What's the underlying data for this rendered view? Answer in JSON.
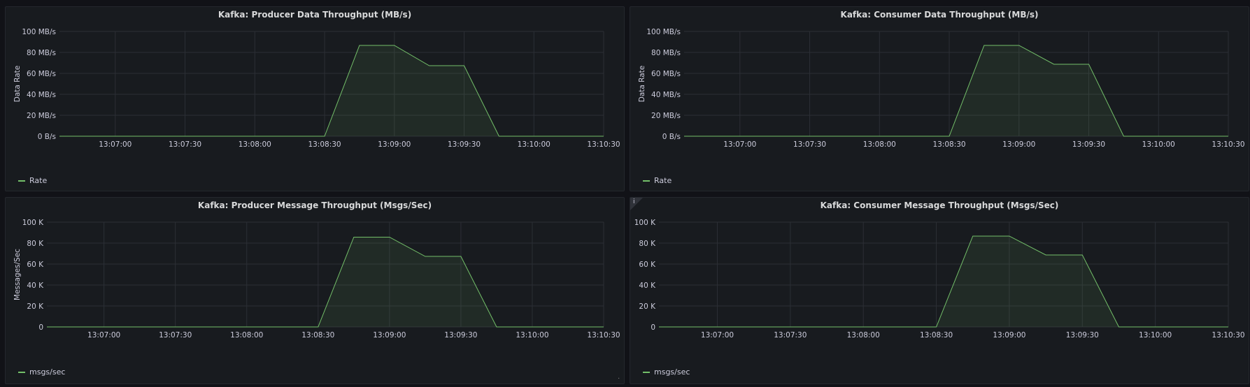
{
  "chart_data": [
    {
      "type": "area",
      "title": "Kafka: Producer Data Throughput (MB/s)",
      "ylabel": "Data Rate",
      "yticks": [
        "0 B/s",
        "20 MB/s",
        "40 MB/s",
        "60 MB/s",
        "80 MB/s",
        "100 MB/s"
      ],
      "ylim": [
        0,
        100
      ],
      "xticks": [
        "13:07:00",
        "13:07:30",
        "13:08:00",
        "13:08:30",
        "13:09:00",
        "13:09:30",
        "13:10:00",
        "13:10:30"
      ],
      "series": [
        {
          "name": "Rate",
          "color": "#73bf69",
          "x": [
            "13:06:36",
            "13:08:30",
            "13:08:45",
            "13:09:00",
            "13:09:15",
            "13:09:30",
            "13:09:45",
            "13:10:30"
          ],
          "values": [
            0,
            0,
            86.7,
            86.7,
            67.3,
            67.3,
            0,
            0
          ]
        }
      ]
    },
    {
      "type": "area",
      "title": "Kafka: Consumer Data Throughput (MB/s)",
      "ylabel": "Data Rate",
      "yticks": [
        "0 B/s",
        "20 MB/s",
        "40 MB/s",
        "60 MB/s",
        "80 MB/s",
        "100 MB/s"
      ],
      "ylim": [
        0,
        100
      ],
      "xticks": [
        "13:07:00",
        "13:07:30",
        "13:08:00",
        "13:08:30",
        "13:09:00",
        "13:09:30",
        "13:10:00",
        "13:10:30"
      ],
      "series": [
        {
          "name": "Rate",
          "color": "#73bf69",
          "x": [
            "13:06:36",
            "13:08:30",
            "13:08:45",
            "13:09:00",
            "13:09:15",
            "13:09:30",
            "13:09:45",
            "13:10:30"
          ],
          "values": [
            0,
            0,
            86.7,
            86.7,
            68.7,
            68.7,
            0,
            0
          ]
        }
      ]
    },
    {
      "type": "area",
      "title": "Kafka: Producer Message Throughput (Msgs/Sec)",
      "ylabel": "Messages/Sec",
      "yticks": [
        "0",
        "20 K",
        "40 K",
        "60 K",
        "80 K",
        "100 K"
      ],
      "ylim": [
        0,
        100
      ],
      "xticks": [
        "13:07:00",
        "13:07:30",
        "13:08:00",
        "13:08:30",
        "13:09:00",
        "13:09:30",
        "13:10:00",
        "13:10:30"
      ],
      "series": [
        {
          "name": "msgs/sec",
          "color": "#73bf69",
          "x": [
            "13:06:36",
            "13:08:30",
            "13:08:45",
            "13:09:00",
            "13:09:15",
            "13:09:30",
            "13:09:45",
            "13:10:30"
          ],
          "values": [
            0,
            0,
            85.7,
            85.7,
            67.3,
            67.3,
            0,
            0
          ]
        }
      ]
    },
    {
      "type": "area",
      "title": "Kafka: Consumer Message Throughput (Msgs/Sec)",
      "ylabel": "",
      "yticks": [
        "0",
        "20 K",
        "40 K",
        "60 K",
        "80 K",
        "100 K"
      ],
      "ylim": [
        0,
        100
      ],
      "xticks": [
        "13:07:00",
        "13:07:30",
        "13:08:00",
        "13:08:30",
        "13:09:00",
        "13:09:30",
        "13:10:00",
        "13:10:30"
      ],
      "series": [
        {
          "name": "msgs/sec",
          "color": "#73bf69",
          "x": [
            "13:06:36",
            "13:08:30",
            "13:08:45",
            "13:09:00",
            "13:09:15",
            "13:09:30",
            "13:09:45",
            "13:10:30"
          ],
          "values": [
            0,
            0,
            86.7,
            86.7,
            68.7,
            68.7,
            0,
            0
          ]
        }
      ]
    }
  ],
  "panels": [
    {
      "info_icon": "",
      "resize_glyph": ""
    },
    {
      "info_icon": "",
      "resize_glyph": ""
    },
    {
      "info_icon": "",
      "resize_glyph": "."
    },
    {
      "info_icon": "i",
      "resize_glyph": ""
    }
  ]
}
